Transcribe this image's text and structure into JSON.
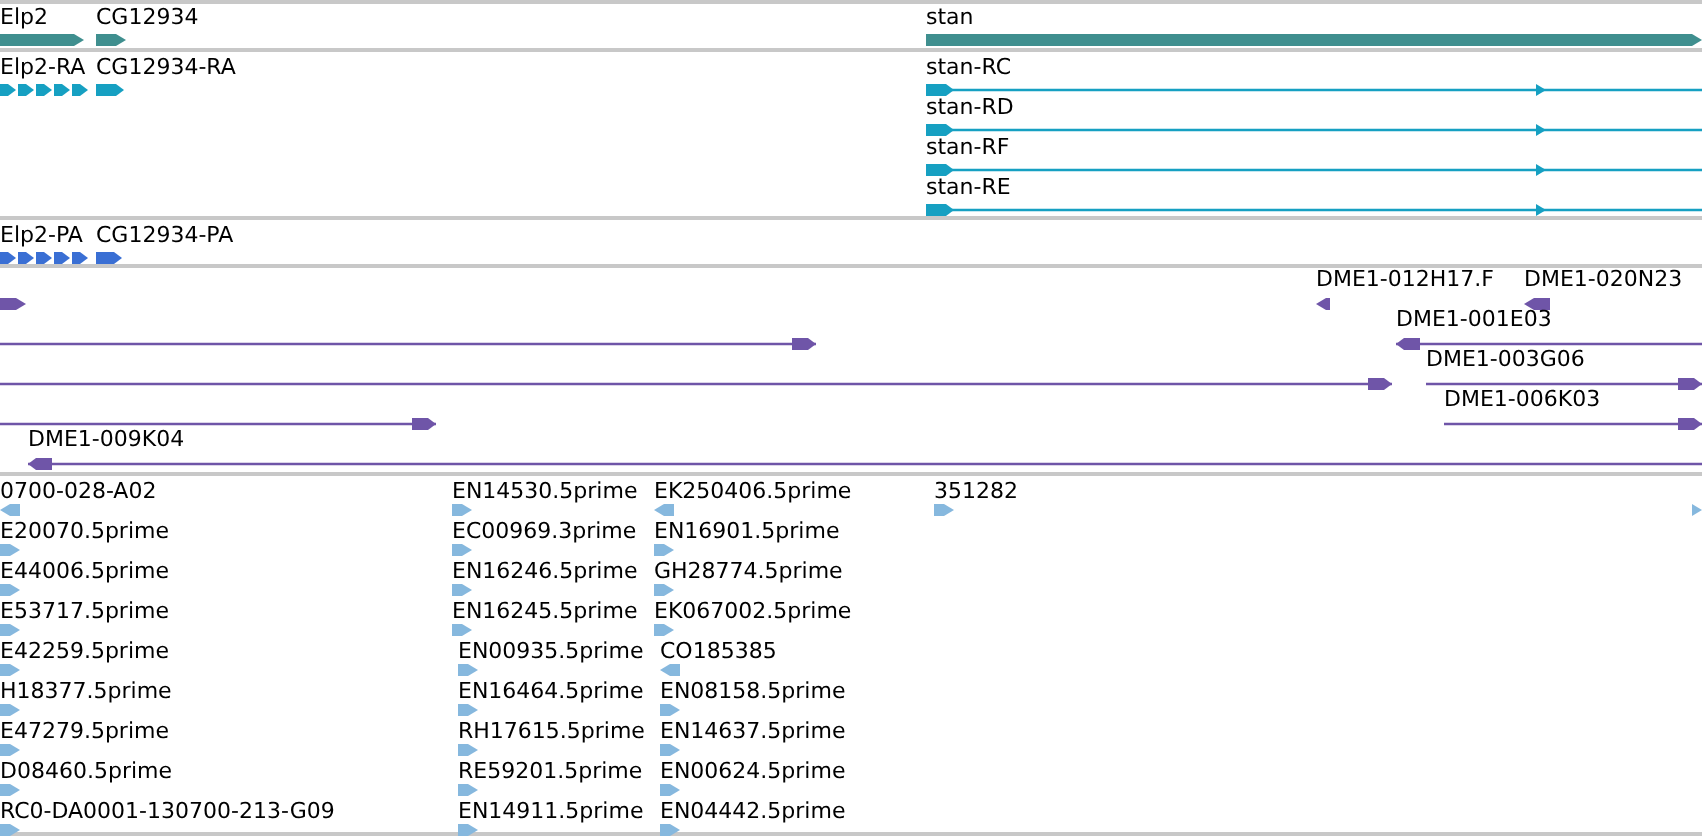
{
  "genes": [
    {
      "label": "Elp2"
    },
    {
      "label": "CG12934"
    },
    {
      "label": "stan"
    }
  ],
  "transcripts": [
    {
      "label": "Elp2-RA"
    },
    {
      "label": "CG12934-RA"
    },
    {
      "label": "stan-RC"
    },
    {
      "label": "stan-RD"
    },
    {
      "label": "stan-RF"
    },
    {
      "label": "stan-RE"
    }
  ],
  "proteins": [
    {
      "label": "Elp2-PA"
    },
    {
      "label": "CG12934-PA"
    }
  ],
  "clones": [
    {
      "reverse": false
    },
    {
      "label": "DME1-012H17.F",
      "reverse": true
    },
    {
      "label": "DME1-020N23",
      "reverse": true
    },
    {
      "reverse": false
    },
    {
      "label": "DME1-001E03",
      "reverse": true
    },
    {
      "reverse": false
    },
    {
      "label": "DME1-003G06",
      "reverse": false
    },
    {
      "reverse": false
    },
    {
      "label": "DME1-006K03",
      "reverse": false
    },
    {
      "label": "DME1-009K04",
      "reverse": true
    }
  ],
  "est_columns": [
    {
      "items": [
        {
          "label": "0700-028-A02",
          "reverse": true
        },
        {
          "label": "E20070.5prime",
          "reverse": false
        },
        {
          "label": "E44006.5prime",
          "reverse": false
        },
        {
          "label": "E53717.5prime",
          "reverse": false
        },
        {
          "label": "E42259.5prime",
          "reverse": false
        },
        {
          "label": "H18377.5prime",
          "reverse": false
        },
        {
          "label": "E47279.5prime",
          "reverse": false
        },
        {
          "label": "D08460.5prime",
          "reverse": false
        },
        {
          "label": "RC0-DA0001-130700-213-G09",
          "reverse": false
        }
      ]
    },
    {
      "items": [
        {
          "label": "EN14530.5prime",
          "reverse": false
        },
        {
          "label": "EC00969.3prime",
          "reverse": false
        },
        {
          "label": "EN16246.5prime",
          "reverse": false
        },
        {
          "label": "EN16245.5prime",
          "reverse": false
        },
        {
          "label": "EN00935.5prime",
          "reverse": false
        },
        {
          "label": "EN16464.5prime",
          "reverse": false
        },
        {
          "label": "RH17615.5prime",
          "reverse": false
        },
        {
          "label": "RE59201.5prime",
          "reverse": false
        },
        {
          "label": "EN14911.5prime",
          "reverse": false
        }
      ]
    },
    {
      "items": [
        {
          "label": "EK250406.5prime",
          "reverse": true
        },
        {
          "label": "EN16901.5prime",
          "reverse": false
        },
        {
          "label": "GH28774.5prime",
          "reverse": false
        },
        {
          "label": "EK067002.5prime",
          "reverse": false
        },
        {
          "label": "CO185385",
          "reverse": true
        },
        {
          "label": "EN08158.5prime",
          "reverse": false
        },
        {
          "label": "EN14637.5prime",
          "reverse": false
        },
        {
          "label": "EN00624.5prime",
          "reverse": false
        },
        {
          "label": "EN04442.5prime",
          "reverse": false
        }
      ]
    },
    {
      "items": [
        {
          "label": "351282",
          "reverse": false
        }
      ]
    },
    {
      "items": [
        {
          "reverse": false
        }
      ]
    }
  ]
}
